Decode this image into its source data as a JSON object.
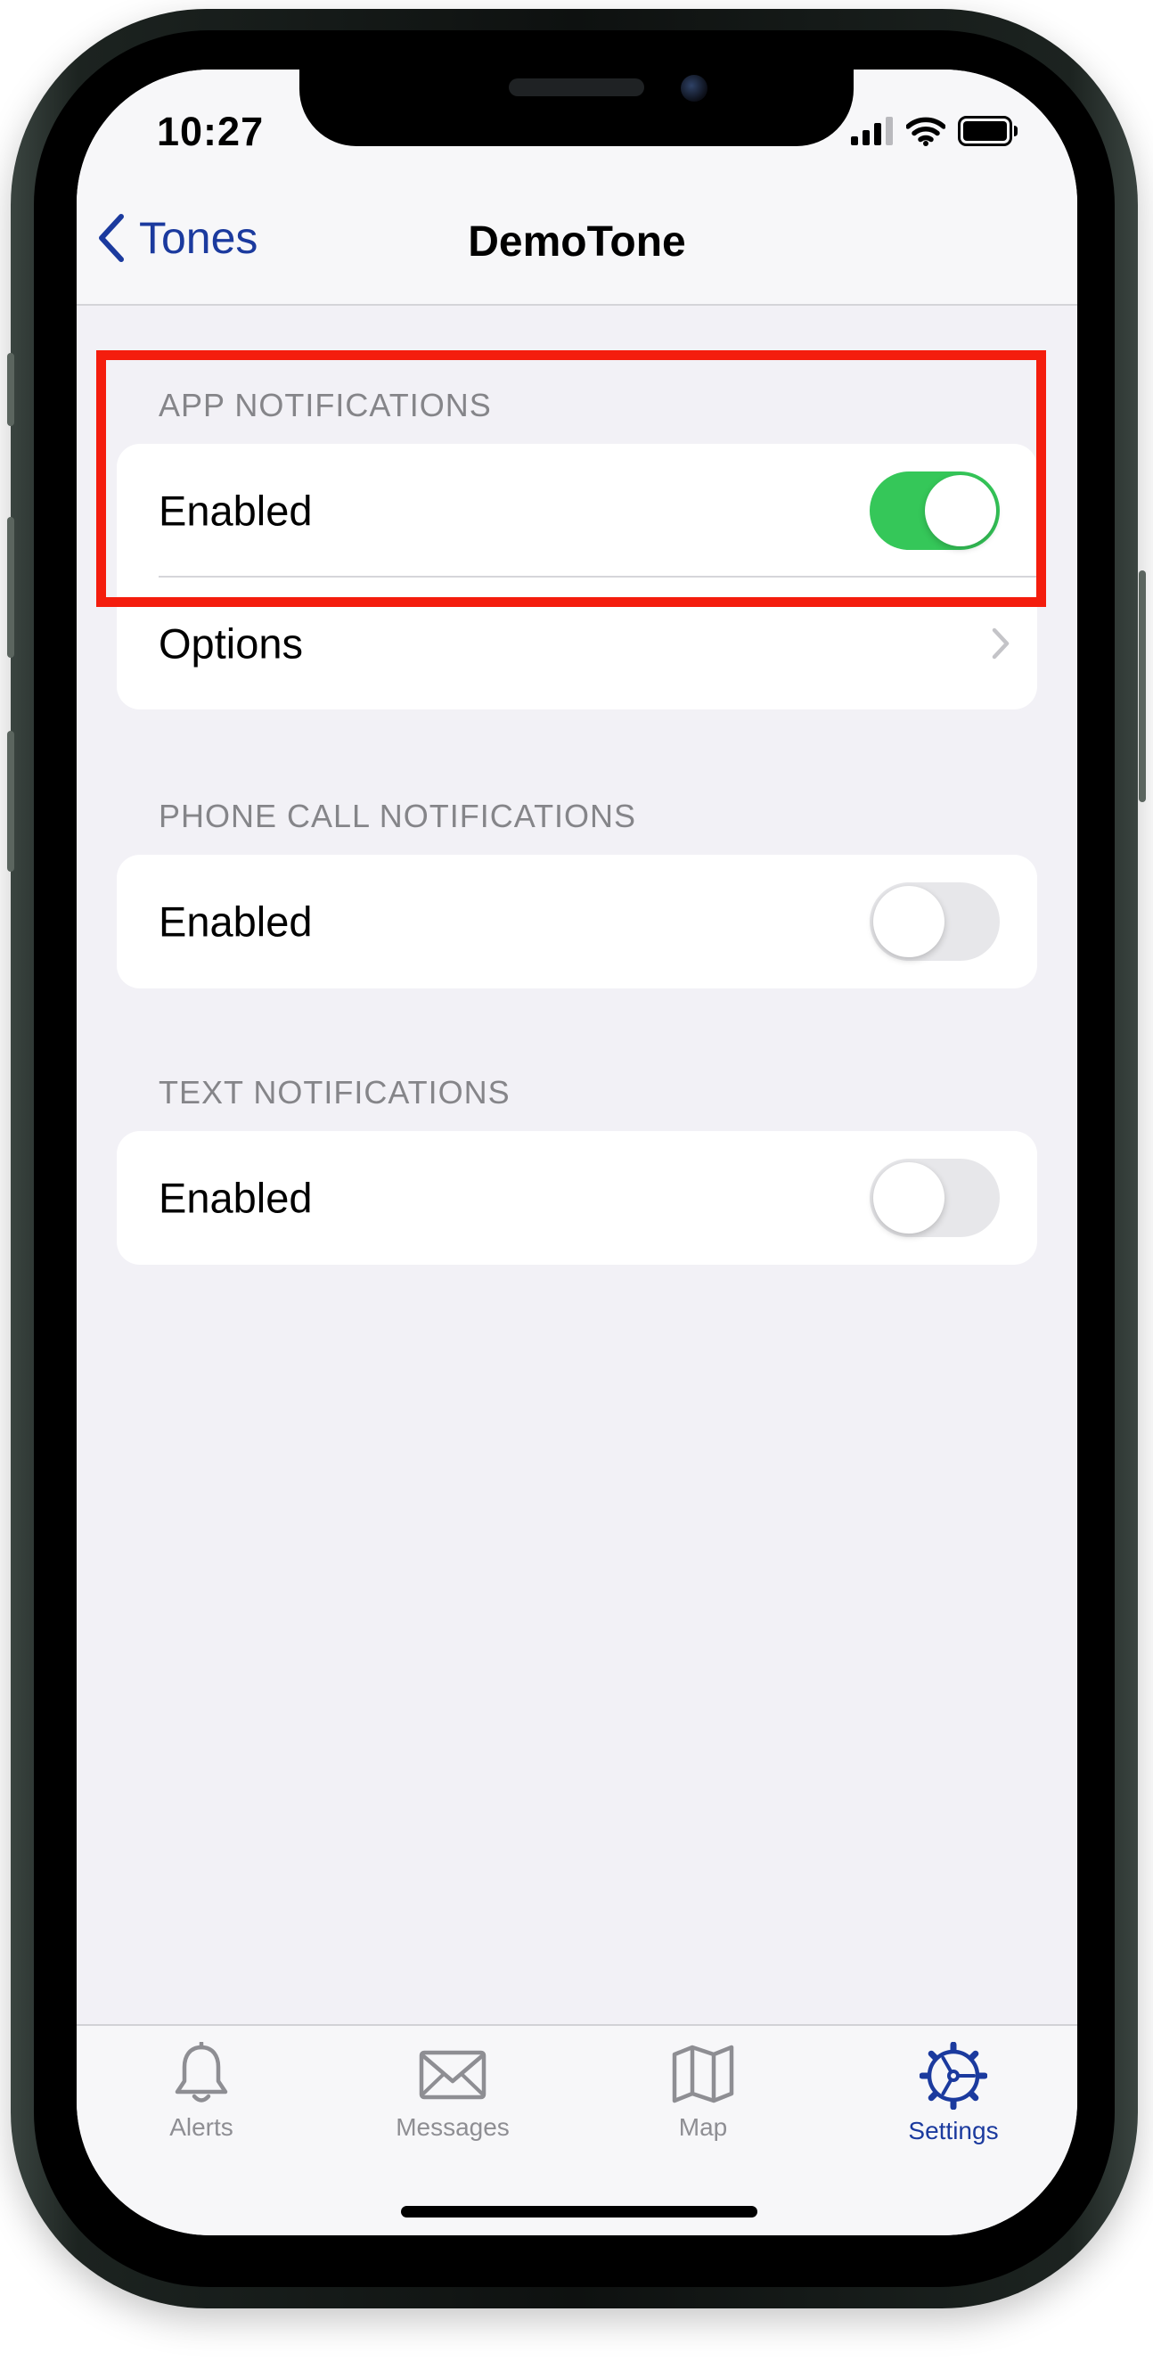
{
  "status_bar": {
    "time": "10:27"
  },
  "nav": {
    "back_label": "Tones",
    "title": "DemoTone"
  },
  "sections": [
    {
      "header": "APP NOTIFICATIONS",
      "rows": [
        {
          "label": "Enabled",
          "toggle_on": true
        },
        {
          "label": "Options"
        }
      ]
    },
    {
      "header": "PHONE CALL NOTIFICATIONS",
      "rows": [
        {
          "label": "Enabled",
          "toggle_on": false
        }
      ]
    },
    {
      "header": "TEXT NOTIFICATIONS",
      "rows": [
        {
          "label": "Enabled",
          "toggle_on": false
        }
      ]
    }
  ],
  "tabs": [
    {
      "label": "Alerts",
      "icon": "bell-icon",
      "active": false
    },
    {
      "label": "Messages",
      "icon": "envelope-icon",
      "active": false
    },
    {
      "label": "Map",
      "icon": "map-icon",
      "active": false
    },
    {
      "label": "Settings",
      "icon": "gear-icon",
      "active": true
    }
  ],
  "colors": {
    "accent": "#1b3a9e",
    "toggle_on": "#35c759",
    "highlight": "#f41d0d",
    "background": "#f2f1f6"
  }
}
